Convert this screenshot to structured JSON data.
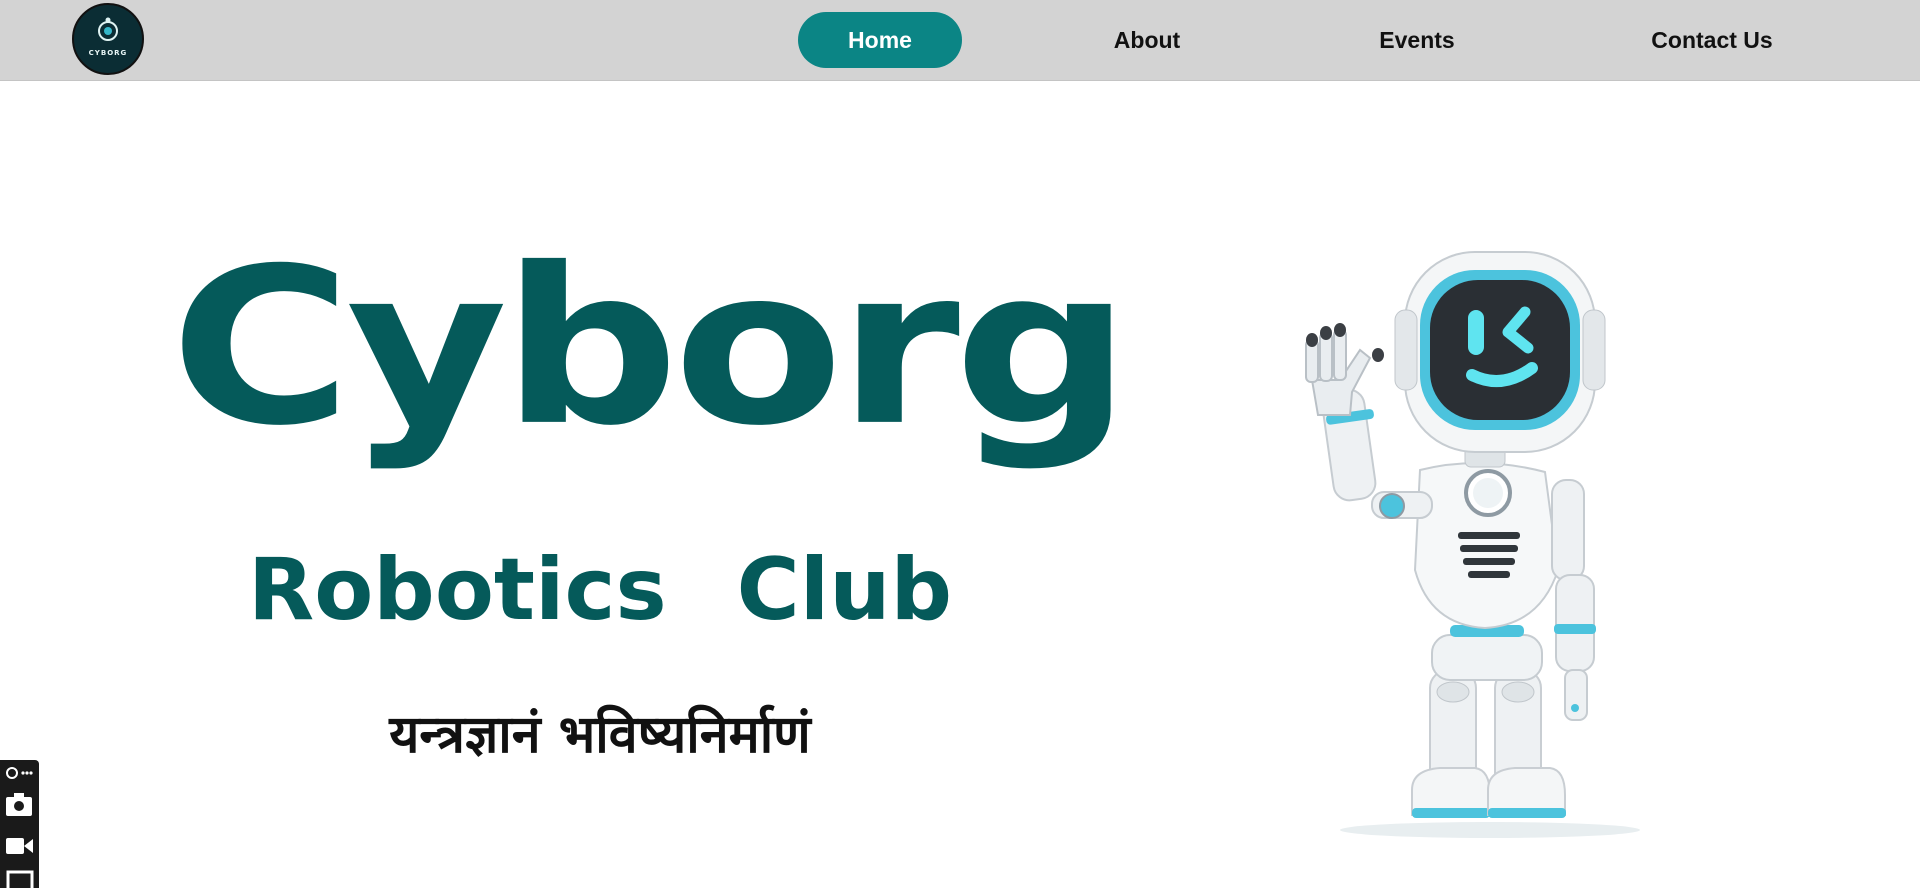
{
  "logo": {
    "text": "CYBORG"
  },
  "nav": {
    "items": [
      {
        "label": "Home",
        "active": true
      },
      {
        "label": "About",
        "active": false
      },
      {
        "label": "Events",
        "active": false
      },
      {
        "label": "Contact Us",
        "active": false
      }
    ]
  },
  "hero": {
    "title": "Cyborg",
    "subtitle": "Robotics Club",
    "tagline": "यन्त्रज्ञानं भविष्यनिर्माणं"
  },
  "colors": {
    "navbar_bg": "#d3d3d3",
    "active_tab": "#0b8585",
    "brand": "#055a5a",
    "robot_accent": "#4cc3dd"
  },
  "dock": {
    "icons": [
      "extension-icon",
      "more-icon",
      "camera-icon",
      "video-icon",
      "window-icon"
    ]
  }
}
